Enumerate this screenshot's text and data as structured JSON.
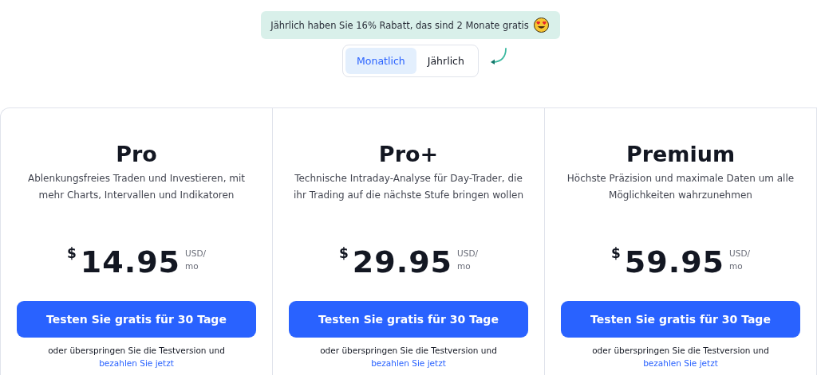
{
  "promo": {
    "text": "Jährlich haben Sie 16% Rabatt, das sind 2 Monate  gratis"
  },
  "billing_toggle": [
    {
      "label": "Monatlich",
      "selected": true
    },
    {
      "label": "Jährlich",
      "selected": false
    }
  ],
  "plans": [
    {
      "name": "Pro",
      "description": "Ablenkungsfreies Traden und Investieren, mit mehr Charts, Intervallen und Indikatoren",
      "currency": "$",
      "price": "14.95",
      "unit_top": "USD/",
      "unit_bottom": "mo",
      "button": "Testen Sie gratis für 30 Tage",
      "note": "oder überspringen Sie die Testversion und",
      "note_link": "bezahlen Sie jetzt"
    },
    {
      "name": "Pro+",
      "description": "Technische Intraday-Analyse für Day-Trader, die ihr Trading auf die nächste Stufe bringen wollen",
      "currency": "$",
      "price": "29.95",
      "unit_top": "USD/",
      "unit_bottom": "mo",
      "button": "Testen Sie gratis für 30 Tage",
      "note": "oder überspringen Sie die Testversion und",
      "note_link": "bezahlen Sie jetzt"
    },
    {
      "name": "Premium",
      "description": "Höchste Präzision und maximale Daten um alle Möglichkeiten wahrzunehmen",
      "currency": "$",
      "price": "59.95",
      "unit_top": "USD/",
      "unit_bottom": "mo",
      "button": "Testen Sie gratis für 30 Tage",
      "note": "oder überspringen Sie die Testversion und",
      "note_link": "bezahlen Sie jetzt"
    }
  ]
}
